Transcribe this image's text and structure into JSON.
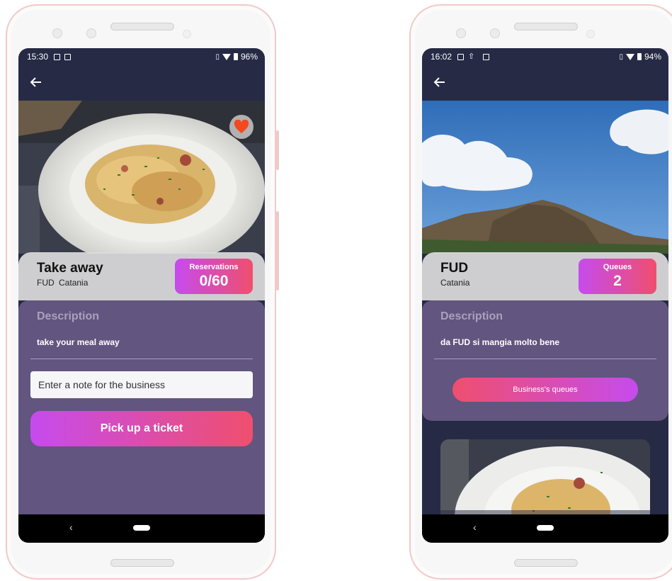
{
  "left_phone": {
    "status": {
      "time": "15:30",
      "battery": "96%"
    },
    "title": "Take away",
    "subtitle_business": "FUD",
    "subtitle_city": "Catania",
    "badge": {
      "label": "Reservations",
      "value": "0/60"
    },
    "description_heading": "Description",
    "description": "take your meal away",
    "note_placeholder": "Enter a note for the business",
    "ticket_button": "Pick up a ticket",
    "nav_back": "‹"
  },
  "right_phone": {
    "status": {
      "time": "16:02",
      "battery": "94%"
    },
    "title": "FUD",
    "subtitle_city": "Catania",
    "badge": {
      "label": "Queues",
      "value": "2"
    },
    "description_heading": "Description",
    "description": "da FUD si mangia molto bene",
    "queues_button": "Business's queues",
    "nav_back": "‹"
  },
  "colors": {
    "screen_bg": "#262a45",
    "panel": "#62557f",
    "gradient_start": "#c64bee",
    "gradient_end": "#ef4f6e",
    "favorite": "#f4481e"
  },
  "icons": [
    "back-arrow-icon",
    "heart-icon",
    "image-icon",
    "download-icon",
    "vibrate-icon",
    "wifi-icon",
    "battery-icon"
  ]
}
